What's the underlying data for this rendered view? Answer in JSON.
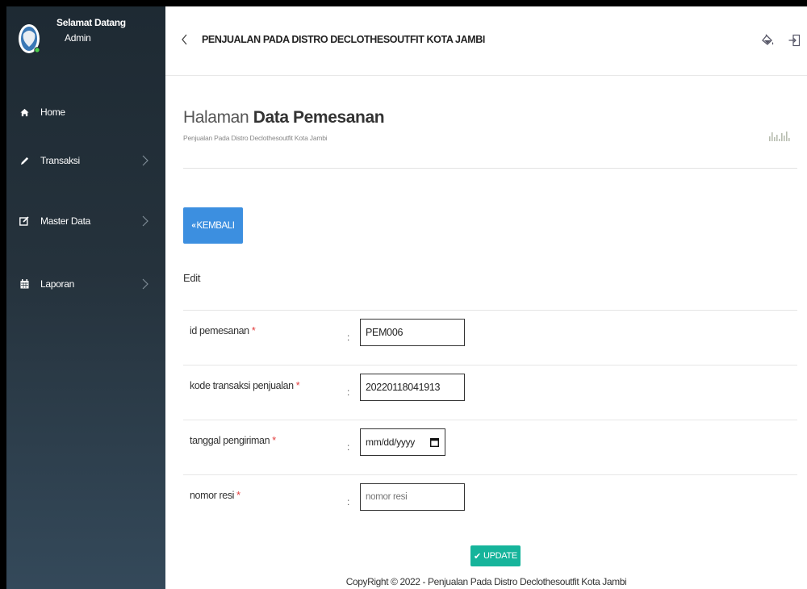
{
  "sidebar": {
    "welcome": "Selamat Datang",
    "role": "Admin",
    "items": [
      {
        "label": "Home",
        "icon": "home-icon"
      },
      {
        "label": "Transaksi",
        "icon": "pencil-icon"
      },
      {
        "label": "Master Data",
        "icon": "edit-icon"
      },
      {
        "label": "Laporan",
        "icon": "calendar-icon"
      }
    ]
  },
  "header": {
    "title": "PENJUALAN PADA DISTRO DECLOTHESOUTFIT KOTA JAMBI"
  },
  "page": {
    "title_light": "Halaman",
    "title_bold": "Data Pemesanan",
    "subtitle": "Penjualan Pada Distro Declothesoutfit Kota Jambi",
    "back_label": "KEMBALI",
    "section_title": "Edit"
  },
  "form": {
    "colon": ":",
    "required_mark": "*",
    "id_pemesanan": {
      "label": "id pemesanan",
      "value": "PEM006"
    },
    "kode_transaksi": {
      "label": "kode transaksi penjualan",
      "value": "20220118041913"
    },
    "tanggal_pengiriman": {
      "label": "tanggal pengiriman",
      "value": "mm/dd/yyyy"
    },
    "nomor_resi": {
      "label": "nomor resi",
      "placeholder": "nomor resi"
    }
  },
  "actions": {
    "update_label": "UPDATE"
  },
  "footer": {
    "text": "CopyRight © 2022 - Penjualan Pada Distro Declothesoutfit Kota Jambi"
  },
  "colors": {
    "sidebar_top": "#1e2a33",
    "sidebar_bottom": "#34495a",
    "primary": "#3c8fe0",
    "success": "#16b49b",
    "required": "#e23c3c"
  }
}
